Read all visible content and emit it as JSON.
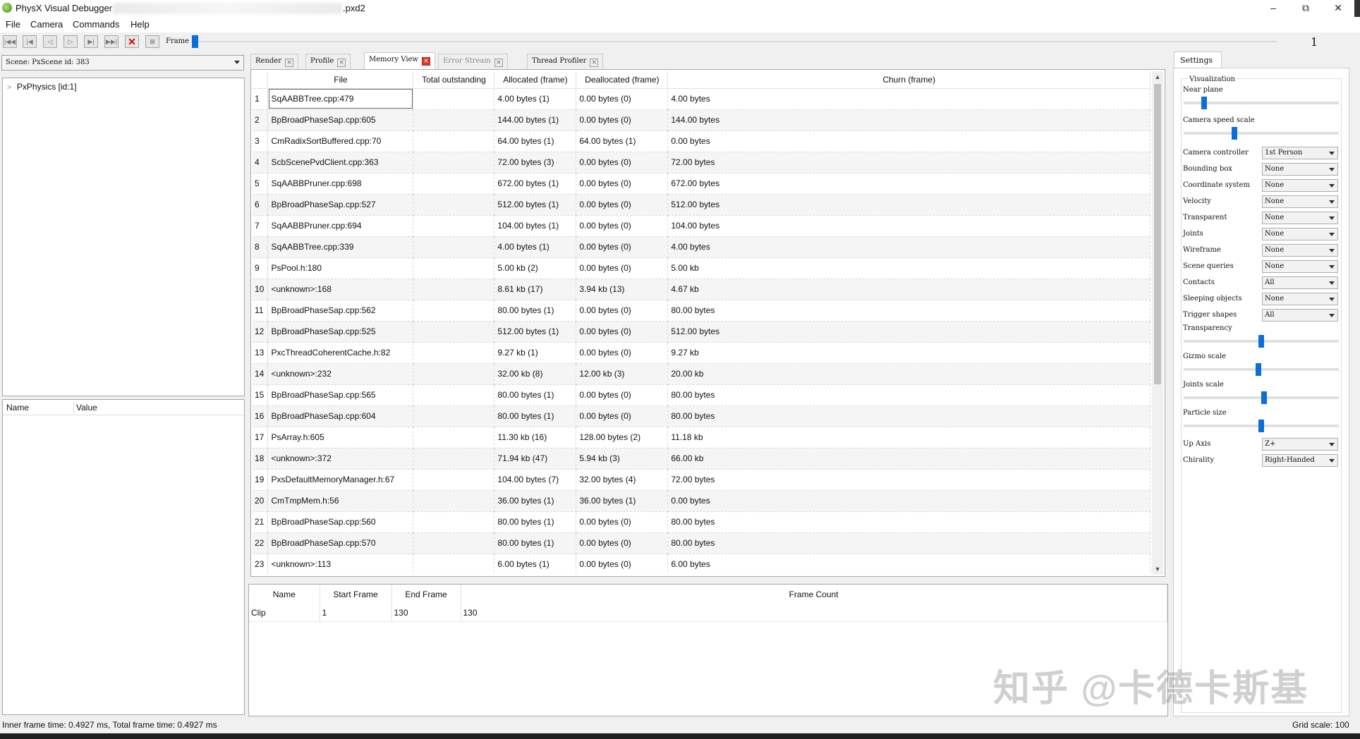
{
  "window": {
    "title": "PhysX Visual Debugger",
    "title_suffix": ".pxd2",
    "controls": {
      "minimize": "–",
      "maximize": "⧉",
      "close": "✕"
    }
  },
  "menu": [
    "File",
    "Camera",
    "Commands",
    "Help"
  ],
  "toolbar": {
    "frame_label": "Frame",
    "frame_value": "1",
    "frame_position_fraction": 0.0,
    "buttons": [
      "first-frame-icon",
      "step-back-icon",
      "play-back-icon",
      "play-icon",
      "step-forward-icon",
      "last-frame-icon",
      "stop-icon",
      "disconnect-icon"
    ]
  },
  "scene_selector": {
    "value": "Scene: PxScene id: 383"
  },
  "tree": {
    "items": [
      {
        "label": "PxPhysics [id:1]"
      }
    ]
  },
  "properties": {
    "columns": [
      "Name",
      "Value"
    ]
  },
  "tabs": [
    {
      "label": "Render",
      "state": "normal"
    },
    {
      "label": "Profile",
      "state": "normal"
    },
    {
      "label": "Memory View",
      "state": "active"
    },
    {
      "label": "Error Stream",
      "state": "disabled"
    },
    {
      "label": "Thread Profiler",
      "state": "normal"
    }
  ],
  "memory_table": {
    "columns": [
      "File",
      "Total outstanding",
      "Allocated (frame)",
      "Deallocated (frame)",
      "Churn (frame)"
    ],
    "rows": [
      [
        "1",
        "SqAABBTree.cpp:479",
        "",
        "4.00 bytes (1)",
        "0.00 bytes (0)",
        "4.00 bytes"
      ],
      [
        "2",
        "BpBroadPhaseSap.cpp:605",
        "",
        "144.00 bytes (1)",
        "0.00 bytes (0)",
        "144.00 bytes"
      ],
      [
        "3",
        "CmRadixSortBuffered.cpp:70",
        "",
        "64.00 bytes (1)",
        "64.00 bytes (1)",
        "0.00 bytes"
      ],
      [
        "4",
        "ScbScenePvdClient.cpp:363",
        "",
        "72.00 bytes (3)",
        "0.00 bytes (0)",
        "72.00 bytes"
      ],
      [
        "5",
        "SqAABBPruner.cpp:698",
        "",
        "672.00 bytes (1)",
        "0.00 bytes (0)",
        "672.00 bytes"
      ],
      [
        "6",
        "BpBroadPhaseSap.cpp:527",
        "",
        "512.00 bytes (1)",
        "0.00 bytes (0)",
        "512.00 bytes"
      ],
      [
        "7",
        "SqAABBPruner.cpp:694",
        "",
        "104.00 bytes (1)",
        "0.00 bytes (0)",
        "104.00 bytes"
      ],
      [
        "8",
        "SqAABBTree.cpp:339",
        "",
        "4.00 bytes (1)",
        "0.00 bytes (0)",
        "4.00 bytes"
      ],
      [
        "9",
        "PsPool.h:180",
        "",
        "5.00 kb (2)",
        "0.00 bytes (0)",
        "5.00 kb"
      ],
      [
        "10",
        "<unknown>:168",
        "",
        "8.61 kb (17)",
        "3.94 kb (13)",
        "4.67 kb"
      ],
      [
        "11",
        "BpBroadPhaseSap.cpp:562",
        "",
        "80.00 bytes (1)",
        "0.00 bytes (0)",
        "80.00 bytes"
      ],
      [
        "12",
        "BpBroadPhaseSap.cpp:525",
        "",
        "512.00 bytes (1)",
        "0.00 bytes (0)",
        "512.00 bytes"
      ],
      [
        "13",
        "PxcThreadCoherentCache.h:82",
        "",
        "9.27 kb (1)",
        "0.00 bytes (0)",
        "9.27 kb"
      ],
      [
        "14",
        "<unknown>:232",
        "",
        "32.00 kb (8)",
        "12.00 kb (3)",
        "20.00 kb"
      ],
      [
        "15",
        "BpBroadPhaseSap.cpp:565",
        "",
        "80.00 bytes (1)",
        "0.00 bytes (0)",
        "80.00 bytes"
      ],
      [
        "16",
        "BpBroadPhaseSap.cpp:604",
        "",
        "80.00 bytes (1)",
        "0.00 bytes (0)",
        "80.00 bytes"
      ],
      [
        "17",
        "PsArray.h:605",
        "",
        "11.30 kb (16)",
        "128.00 bytes (2)",
        "11.18 kb"
      ],
      [
        "18",
        "<unknown>:372",
        "",
        "71.94 kb (47)",
        "5.94 kb (3)",
        "66.00 kb"
      ],
      [
        "19",
        "PxsDefaultMemoryManager.h:67",
        "",
        "104.00 bytes (7)",
        "32.00 bytes (4)",
        "72.00 bytes"
      ],
      [
        "20",
        "CmTmpMem.h:56",
        "",
        "36.00 bytes (1)",
        "36.00 bytes (1)",
        "0.00 bytes"
      ],
      [
        "21",
        "BpBroadPhaseSap.cpp:560",
        "",
        "80.00 bytes (1)",
        "0.00 bytes (0)",
        "80.00 bytes"
      ],
      [
        "22",
        "BpBroadPhaseSap.cpp:570",
        "",
        "80.00 bytes (1)",
        "0.00 bytes (0)",
        "80.00 bytes"
      ],
      [
        "23",
        "<unknown>:113",
        "",
        "6.00 bytes (1)",
        "0.00 bytes (0)",
        "6.00 bytes"
      ]
    ]
  },
  "clips_table": {
    "columns": [
      "Name",
      "Start Frame",
      "End Frame",
      "Frame Count"
    ],
    "rows": [
      [
        "Clip",
        "1",
        "130",
        "130"
      ]
    ]
  },
  "settings": {
    "tab_label": "Settings",
    "group_title": "Visualization",
    "sliders": [
      {
        "label": "Near plane",
        "value_fraction": 0.12
      },
      {
        "label": "Camera speed scale",
        "value_fraction": 0.32
      },
      {
        "label": "Transparency",
        "value_fraction": 0.5
      },
      {
        "label": "Gizmo scale",
        "value_fraction": 0.48
      },
      {
        "label": "Joints scale",
        "value_fraction": 0.52
      },
      {
        "label": "Particle size",
        "value_fraction": 0.5
      }
    ],
    "dropdowns_a": [
      {
        "label": "Camera controller",
        "value": "1st Person"
      },
      {
        "label": "Bounding box",
        "value": "None"
      },
      {
        "label": "Coordinate system",
        "value": "None"
      },
      {
        "label": "Velocity",
        "value": "None"
      },
      {
        "label": "Transparent",
        "value": "None"
      },
      {
        "label": "Joints",
        "value": "None"
      },
      {
        "label": "Wireframe",
        "value": "None"
      },
      {
        "label": "Scene queries",
        "value": "None"
      },
      {
        "label": "Contacts",
        "value": "All"
      },
      {
        "label": "Sleeping objects",
        "value": "None"
      },
      {
        "label": "Trigger shapes",
        "value": "All"
      }
    ],
    "dropdowns_b": [
      {
        "label": "Up Axis",
        "value": "Z+"
      },
      {
        "label": "Chirality",
        "value": "Right-Handed"
      }
    ]
  },
  "status": {
    "left": "Inner frame time: 0.4927 ms, Total frame time: 0.4927 ms",
    "right": "Grid scale: 100"
  },
  "watermark": "知乎 @卡德卡斯基"
}
